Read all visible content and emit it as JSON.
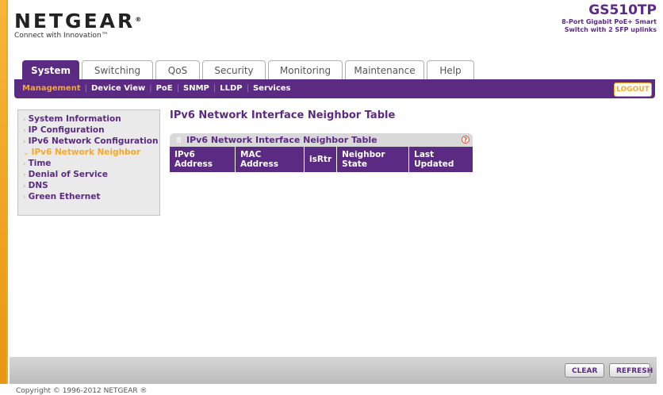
{
  "header": {
    "brand": "NETGEAR",
    "brand_mark": "®",
    "tagline": "Connect with Innovation™",
    "model": "GS510TP",
    "model_desc": "8-Port Gigabit PoE+ Smart Switch with 2 SFP uplinks"
  },
  "tabs": [
    {
      "label": "System",
      "active": true
    },
    {
      "label": "Switching"
    },
    {
      "label": "QoS"
    },
    {
      "label": "Security"
    },
    {
      "label": "Monitoring"
    },
    {
      "label": "Maintenance"
    },
    {
      "label": "Help"
    }
  ],
  "subnav": {
    "items": [
      "Management",
      "Device View",
      "PoE",
      "SNMP",
      "LLDP",
      "Services"
    ],
    "active": "Management",
    "logout": "LOGOUT"
  },
  "menu": {
    "items": [
      "System Information",
      "IP Configuration",
      "IPv6 Network Configuration",
      "IPv6 Network Neighbor",
      "Time",
      "Denial of Service",
      "DNS",
      "Green Ethernet"
    ],
    "active": "IPv6 Network Neighbor"
  },
  "main": {
    "title": "IPv6 Network Interface Neighbor Table",
    "panel_title": "IPv6 Network Interface Neighbor Table",
    "help": "?",
    "columns": [
      "IPv6 Address",
      "MAC Address",
      "isRtr",
      "Neighbor State",
      "Last Updated"
    ]
  },
  "buttons": {
    "clear": "CLEAR",
    "refresh": "REFRESH"
  },
  "footer": {
    "copyright": "Copyright © 1996-2012 NETGEAR ®"
  },
  "colors": {
    "brand_purple": "#5b2a83",
    "accent_orange": "#f7a828"
  }
}
